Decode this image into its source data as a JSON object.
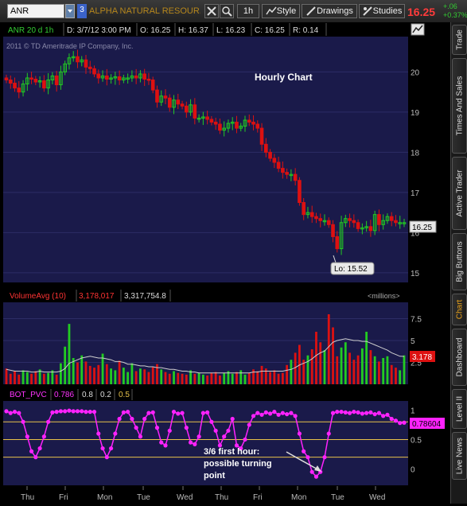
{
  "toolbar": {
    "symbol": "ANR",
    "link_number": "3",
    "company": "ALPHA NATURAL RESOUR...",
    "timeframe": "1h",
    "style_label": "Style",
    "drawings_label": "Drawings",
    "studies_label": "Studies",
    "last_price": "16.25",
    "change_abs": "+.06",
    "change_pct": "+0.37%"
  },
  "sidebar": {
    "tabs": [
      "Trade",
      "Times And Sales",
      "Active Trader",
      "Big Buttons",
      "Chart",
      "Dashboard",
      "Level II",
      "Live News"
    ],
    "active": "Chart"
  },
  "price_panel": {
    "header": {
      "symbol": "ANR 20 d 1h",
      "date": "D: 3/7/12 3:00 PM",
      "open": "O: 16.25",
      "high": "H: 16.37",
      "low": "L: 16.23",
      "close": "C: 16.25",
      "range": "R: 0.14"
    },
    "copyright": "2011 © TD Ameritrade IP Company, Inc.",
    "annotation": "Hourly Chart",
    "low_label": "Lo: 15.52",
    "last_label": "16.25",
    "y_ticks": [
      "20",
      "19",
      "18",
      "17",
      "16",
      "15"
    ]
  },
  "volume_panel": {
    "label": "VolumeAvg (10)",
    "avg_value": "3,178,017",
    "volume_value": "3,317,754.8",
    "units": "<millions>",
    "y_ticks": [
      "7.5",
      "5",
      "2.5"
    ],
    "last_label": "3.178"
  },
  "pvc_panel": {
    "label": "BOT_PVC",
    "value": "0.786",
    "level1": "0.8",
    "level2": "0.2",
    "level3": "0.5",
    "last_label": "0.78604",
    "y_ticks": [
      "1",
      "0.5",
      "0"
    ],
    "annotation": [
      "3/6 first hour:",
      "possible turning",
      "point"
    ]
  },
  "x_axis": [
    "Thu",
    "Fri",
    "Mon",
    "Tue",
    "Wed",
    "Thu",
    "Fri",
    "Mon",
    "Tue",
    "Wed"
  ],
  "colors": {
    "panel_bg": "#1a1a4a",
    "up": "#22cc22",
    "down": "#dd1111",
    "pvc": "#ff22ff",
    "level": "#e8c24a",
    "accent": "#b6871c"
  },
  "chart_data": [
    {
      "type": "candlestick",
      "title": "Hourly Chart",
      "ylim": [
        14.8,
        20.8
      ],
      "closes": [
        19.8,
        19.72,
        19.6,
        19.5,
        19.7,
        19.85,
        19.82,
        19.75,
        19.78,
        19.6,
        19.8,
        19.9,
        19.68,
        20.0,
        20.2,
        20.35,
        20.38,
        20.25,
        20.3,
        20.12,
        20.08,
        19.95,
        19.85,
        19.9,
        19.82,
        19.85,
        19.88,
        19.8,
        19.85,
        19.85,
        19.9,
        19.85,
        19.95,
        19.82,
        19.8,
        19.55,
        19.25,
        19.4,
        19.35,
        19.12,
        19.3,
        19.2,
        19.15,
        19.0,
        19.18,
        18.85,
        18.85,
        18.88,
        18.82,
        18.75,
        18.7,
        18.55,
        18.6,
        18.72,
        18.75,
        18.6,
        18.65,
        18.8,
        18.75,
        18.7,
        18.6,
        18.2,
        18.0,
        17.85,
        17.75,
        17.6,
        17.5,
        17.45,
        17.45,
        17.3,
        16.75,
        16.45,
        16.5,
        16.4,
        16.35,
        16.3,
        16.3,
        16.2,
        15.9,
        15.6,
        16.25,
        16.35,
        16.3,
        16.25,
        16.1,
        16.12,
        16.15,
        16.05,
        16.45,
        16.2,
        16.3,
        16.4,
        16.3,
        16.25,
        16.25,
        16.25
      ],
      "highs_lows_note": "approximate"
    },
    {
      "type": "bar",
      "title": "VolumeAvg (10)",
      "ylim": [
        0,
        9
      ],
      "values": [
        1.8,
        1.2,
        1.5,
        1.1,
        1.6,
        1.4,
        1.2,
        1.5,
        1.7,
        1.2,
        1.3,
        1.6,
        1.1,
        2.4,
        4.3,
        6.9,
        3.0,
        2.5,
        3.3,
        2.6,
        2.1,
        1.9,
        2.2,
        3.5,
        2.3,
        1.8,
        1.6,
        2.7,
        1.9,
        1.4,
        2.4,
        1.5,
        1.8,
        1.7,
        1.4,
        2.0,
        2.3,
        1.7,
        1.4,
        1.2,
        1.5,
        1.3,
        1.2,
        1.1,
        1.6,
        1.2,
        1.3,
        1.1,
        1.0,
        1.3,
        1.4,
        1.0,
        1.3,
        1.5,
        1.2,
        1.4,
        1.6,
        1.1,
        1.3,
        1.7,
        1.5,
        2.1,
        1.8,
        1.4,
        1.6,
        1.2,
        1.3,
        2.2,
        2.8,
        3.6,
        4.5,
        2.8,
        3.3,
        4.0,
        6.0,
        4.8,
        3.9,
        8.0,
        6.5,
        3.2,
        4.2,
        4.8,
        3.6,
        2.8,
        3.3,
        4.1,
        6.0,
        3.9,
        3.2,
        2.6,
        3.0,
        3.2,
        2.2,
        1.9,
        1.6,
        3.3
      ],
      "avg": [
        1.7,
        1.6,
        1.5,
        1.5,
        1.5,
        1.5,
        1.4,
        1.4,
        1.5,
        1.4,
        1.4,
        1.4,
        1.4,
        1.5,
        1.8,
        2.4,
        2.6,
        2.8,
        3.0,
        3.1,
        3.2,
        3.1,
        3.0,
        3.0,
        2.9,
        2.8,
        2.6,
        2.6,
        2.5,
        2.3,
        2.3,
        2.2,
        2.1,
        2.1,
        2.0,
        2.0,
        1.9,
        1.9,
        1.8,
        1.7,
        1.7,
        1.6,
        1.5,
        1.5,
        1.4,
        1.4,
        1.3,
        1.3,
        1.3,
        1.3,
        1.3,
        1.3,
        1.3,
        1.3,
        1.3,
        1.3,
        1.3,
        1.3,
        1.3,
        1.4,
        1.4,
        1.5,
        1.5,
        1.5,
        1.5,
        1.5,
        1.5,
        1.6,
        1.7,
        1.9,
        2.2,
        2.4,
        2.6,
        2.9,
        3.3,
        3.6,
        3.8,
        4.3,
        4.8,
        5.0,
        5.1,
        5.2,
        5.1,
        5.0,
        5.0,
        4.9,
        4.9,
        4.7,
        4.5,
        4.3,
        4.1,
        3.9,
        3.6,
        3.4,
        3.2,
        3.18
      ]
    },
    {
      "type": "line",
      "title": "BOT_PVC",
      "ylim": [
        -0.25,
        1.1
      ],
      "values": [
        0.98,
        0.95,
        0.97,
        0.95,
        0.8,
        0.55,
        0.3,
        0.2,
        0.35,
        0.55,
        0.8,
        0.96,
        0.97,
        0.98,
        0.98,
        0.99,
        0.98,
        0.98,
        0.98,
        0.97,
        0.97,
        0.97,
        0.6,
        0.35,
        0.2,
        0.35,
        0.6,
        0.85,
        0.96,
        0.97,
        0.85,
        0.7,
        0.55,
        0.85,
        0.95,
        0.96,
        0.7,
        0.45,
        0.4,
        0.65,
        0.97,
        0.94,
        0.95,
        0.7,
        0.45,
        0.42,
        0.55,
        0.95,
        0.96,
        0.8,
        0.65,
        0.4,
        0.55,
        0.65,
        0.85,
        0.4,
        0.35,
        0.5,
        0.75,
        0.9,
        0.95,
        0.92,
        0.96,
        0.94,
        0.97,
        0.92,
        0.95,
        0.93,
        0.95,
        0.9,
        0.6,
        0.3,
        0.2,
        -0.05,
        -0.13,
        -0.05,
        0.2,
        0.6,
        0.95,
        0.97,
        0.97,
        0.96,
        0.95,
        0.97,
        0.96,
        0.94,
        0.95,
        0.96,
        0.93,
        0.95,
        0.9,
        0.92,
        0.85,
        0.82,
        0.78,
        0.786
      ]
    }
  ]
}
